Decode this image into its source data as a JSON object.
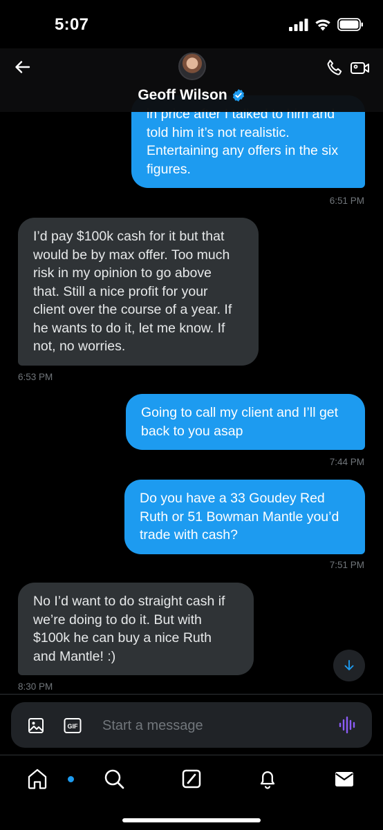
{
  "status_bar": {
    "time": "5:07"
  },
  "header": {
    "contact_name": "Geoff Wilson",
    "verified": true
  },
  "messages": [
    {
      "from": "me",
      "text": "in price after I talked to him and\ntold him it’s not realistic.\nEntertaining any offers in the six\nfigures.",
      "time": "6:51 PM"
    },
    {
      "from": "them",
      "text": "I’d pay $100k cash for it but that\nwould be by max offer. Too much\nrisk in my opinion to go above\nthat. Still a nice profit for your\nclient over the course of a year. If\nhe wants to do it, let me know. If\nnot, no worries.",
      "time": "6:53 PM"
    },
    {
      "from": "me",
      "text": "Going to call my client and I’ll get\nback to you asap",
      "time": "7:44 PM"
    },
    {
      "from": "me",
      "text": "Do you have a 33 Goudey Red\nRuth or 51 Bowman Mantle you’d\ntrade with cash?",
      "time": "7:51 PM"
    },
    {
      "from": "them",
      "text": "No I’d want to do straight cash if\nwe’re doing to do it. But with\n$100k he can buy a nice Ruth\nand Mantle! :)",
      "time": "8:30 PM"
    }
  ],
  "composer": {
    "placeholder": "Start a message",
    "gif_label": "GIF"
  },
  "tabs": [
    {
      "icon": "home-icon",
      "has_notification_dot": true
    },
    {
      "icon": "search-icon"
    },
    {
      "icon": "grok-icon"
    },
    {
      "icon": "bell-icon"
    },
    {
      "icon": "mail-icon"
    }
  ],
  "colors": {
    "accent": "#1d9bf0",
    "received_bubble": "#2f3336",
    "background": "#000000",
    "voice_icon": "#8b5cf6"
  }
}
